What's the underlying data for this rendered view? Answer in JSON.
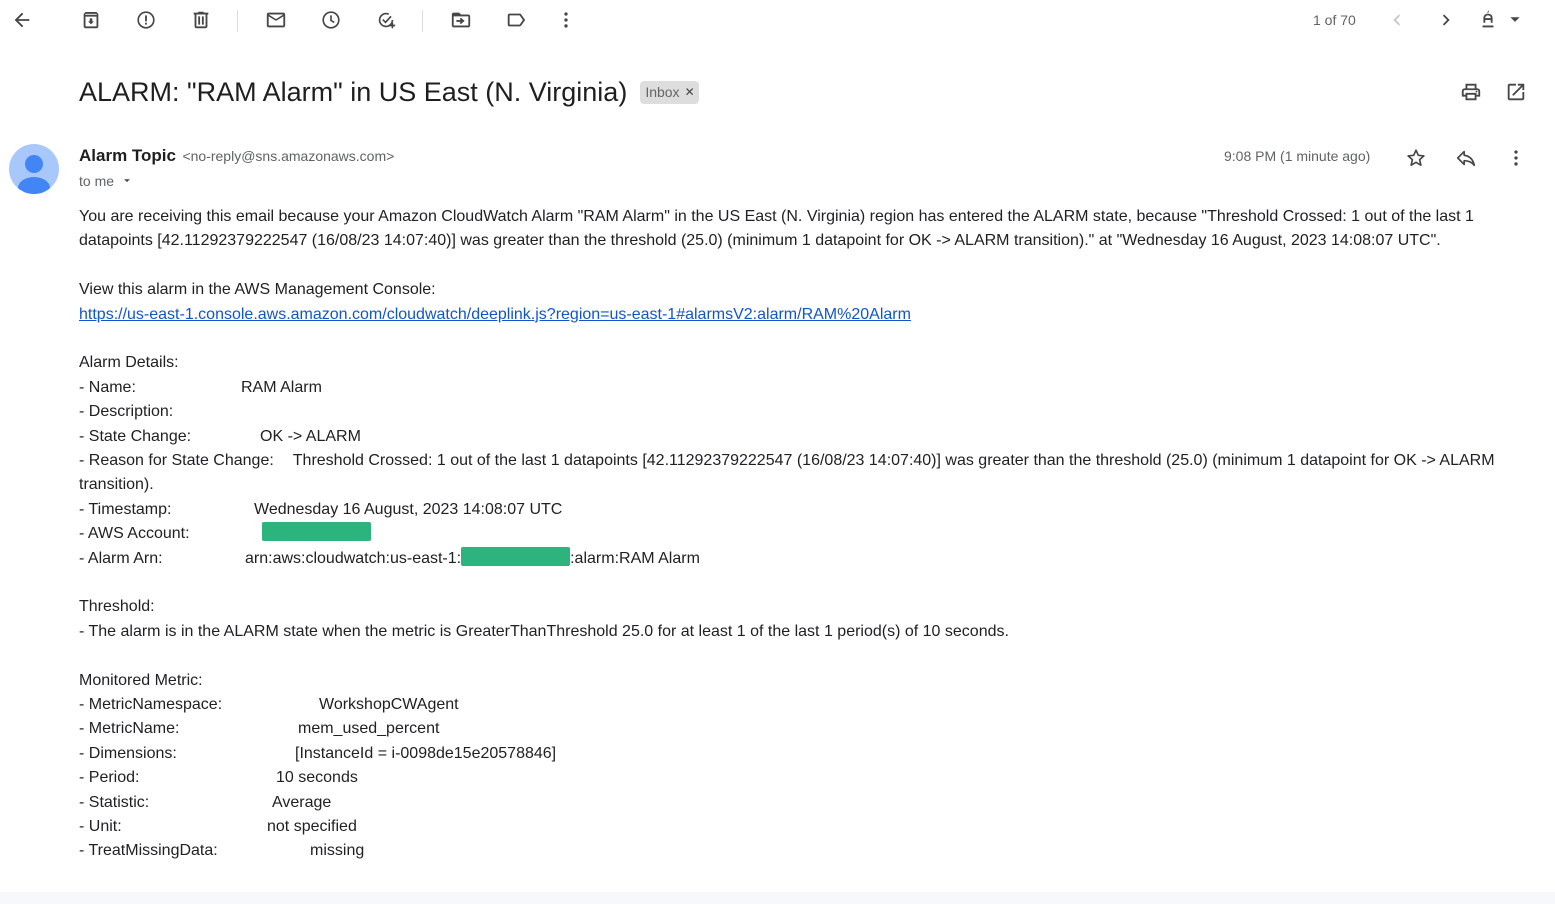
{
  "toolbar": {
    "icons": [
      "back-arrow-icon",
      "archive-icon",
      "report-spam-icon",
      "delete-icon",
      "mark-unread-icon",
      "snooze-icon",
      "add-to-tasks-icon",
      "move-to-icon",
      "labels-icon",
      "more-vert-icon"
    ],
    "counter": "1 of 70"
  },
  "subject": "ALARM: \"RAM Alarm\" in US East (N. Virginia)",
  "label_chip": "Inbox",
  "sender": {
    "name": "Alarm Topic",
    "email": "<no-reply@sns.amazonaws.com>",
    "to": "to me",
    "time": "9:08 PM (1 minute ago)"
  },
  "body": {
    "intro": "You are receiving this email because your Amazon CloudWatch Alarm \"RAM Alarm\" in the US East (N. Virginia) region has entered the ALARM state, because \"Threshold Crossed: 1 out of the last 1 datapoints [42.11292379222547 (16/08/23 14:07:40)] was greater than the threshold (25.0) (minimum 1 datapoint for OK -> ALARM transition).\" at \"Wednesday 16 August, 2023 14:08:07 UTC\".",
    "console_label": "View this alarm in the AWS Management Console:",
    "console_link": "https://us-east-1.console.aws.amazon.com/cloudwatch/deeplink.js?region=us-east-1#alarmsV2:alarm/RAM%20Alarm",
    "details_heading": "Alarm Details:",
    "details": {
      "name_key": "- Name:",
      "name_val": "RAM Alarm",
      "desc_key": "- Description:",
      "state_key": "- State Change:",
      "state_val": "OK -> ALARM",
      "reason_key": "- Reason for State Change:",
      "reason_val": "Threshold Crossed: 1 out of the last 1 datapoints [42.11292379222547 (16/08/23 14:07:40)] was greater than the threshold (25.0) (minimum 1 datapoint for OK -> ALARM transition).",
      "ts_key": "- Timestamp:",
      "ts_val": "Wednesday 16 August, 2023 14:08:07 UTC",
      "account_key": "- AWS Account:",
      "arn_key": "- Alarm Arn:",
      "arn_prefix": "arn:aws:cloudwatch:us-east-1:",
      "arn_suffix": ":alarm:RAM Alarm"
    },
    "threshold_heading": "Threshold:",
    "threshold_text": "- The alarm is in the ALARM state when the metric is GreaterThanThreshold 25.0 for at least 1 of the last 1 period(s) of 10 seconds.",
    "metric_heading": "Monitored Metric:",
    "metric": {
      "ns_key": "- MetricNamespace:",
      "ns_val": "WorkshopCWAgent",
      "name_key": "- MetricName:",
      "name_val": "mem_used_percent",
      "dim_key": "- Dimensions:",
      "dim_val": "[InstanceId = i-0098de15e20578846]",
      "period_key": "- Period:",
      "period_val": "10 seconds",
      "stat_key": "- Statistic:",
      "stat_val": "Average",
      "unit_key": "- Unit:",
      "unit_val": "not specified",
      "missing_key": "- TreatMissingData:",
      "missing_val": "missing"
    }
  },
  "colors": {
    "link": "#1155cc",
    "redaction": "#2db37d",
    "avatar": "#a8c7fa",
    "avatar_figure": "#4285f4"
  }
}
